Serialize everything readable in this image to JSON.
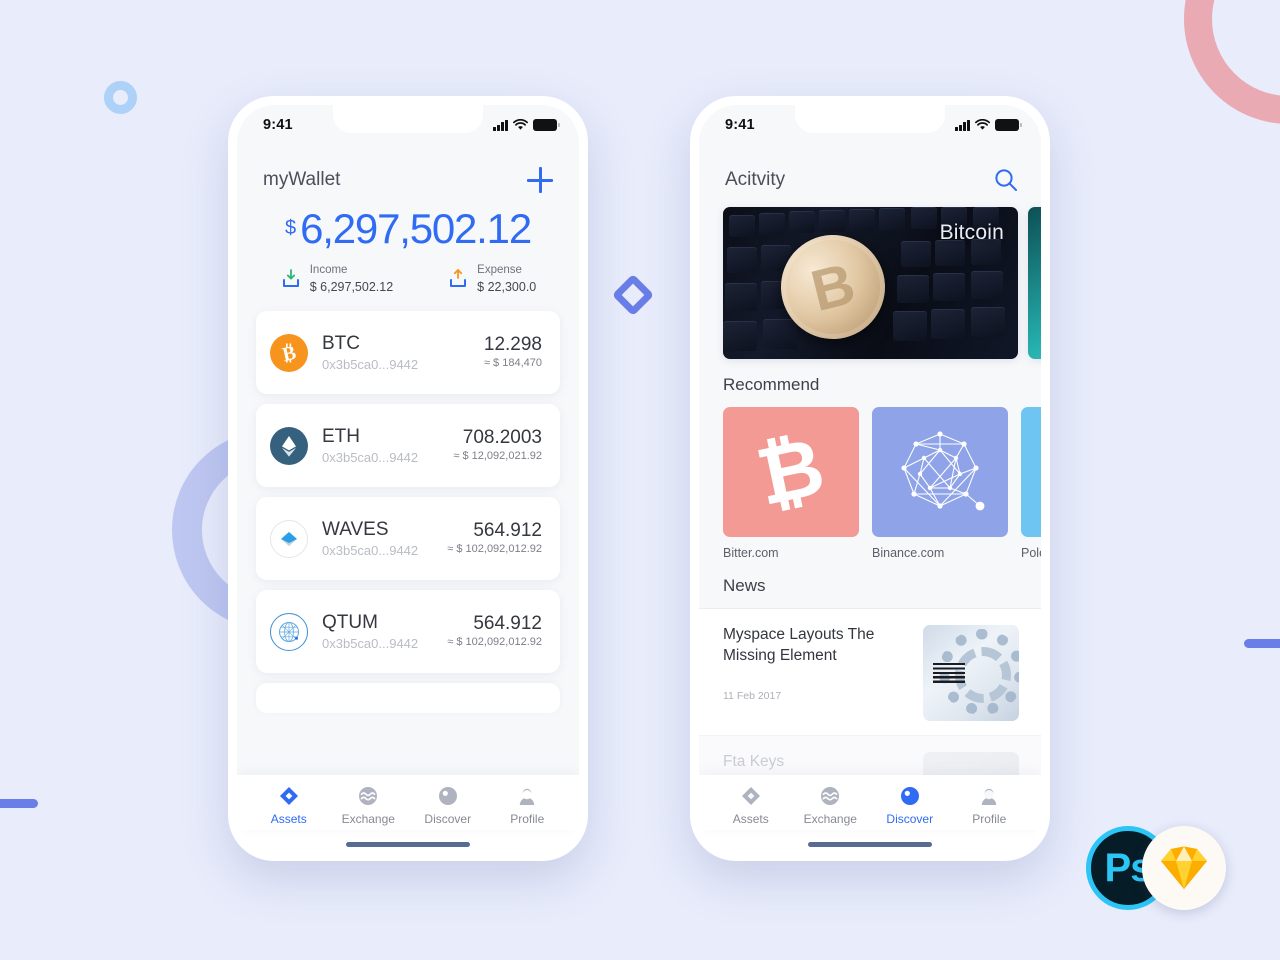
{
  "meta": {
    "background_color": "#e8ecfb",
    "accent_color": "#2f6bf3"
  },
  "decorations": {
    "ring_small_color": "#aed2f7",
    "ring_big_color": "#b6c1ee",
    "arc_pink_color": "#e9aab4",
    "diamond_color": "#6a7ee8",
    "bar_color": "#6a7ee8",
    "badges": [
      {
        "name": "photoshop-badge",
        "label": "Ps"
      },
      {
        "name": "sketch-badge",
        "label": ""
      }
    ]
  },
  "phone1": {
    "status_bar": {
      "time": "9:41",
      "signal": "signal-icon",
      "wifi": "wifi-icon",
      "battery": "battery-icon"
    },
    "header": {
      "title": "myWallet",
      "add_icon": "plus-icon"
    },
    "balance": {
      "currency_symbol": "$",
      "amount": "6,297,502.12",
      "income": {
        "label": "Income",
        "value": "$ 6,297,502.12",
        "icon": "income-arrow-down-icon"
      },
      "expense": {
        "label": "Expense",
        "value": "$ 22,300.0",
        "icon": "expense-arrow-up-icon"
      }
    },
    "assets": [
      {
        "symbol": "BTC",
        "address": "0x3b5ca0...9442",
        "amount": "12.298",
        "fiat": "≈ $ 184,470",
        "icon": "btc-coin-icon",
        "color": "#f7941e"
      },
      {
        "symbol": "ETH",
        "address": "0x3b5ca0...9442",
        "amount": "708.2003",
        "fiat": "≈ $ 12,092,021.92",
        "icon": "eth-coin-icon",
        "color": "#35617f"
      },
      {
        "symbol": "WAVES",
        "address": "0x3b5ca0...9442",
        "amount": "564.912",
        "fiat": "≈ $ 102,092,012.92",
        "icon": "waves-coin-icon",
        "color": "#28a0e8"
      },
      {
        "symbol": "QTUM",
        "address": "0x3b5ca0...9442",
        "amount": "564.912",
        "fiat": "≈ $ 102,092,012.92",
        "icon": "qtum-coin-icon",
        "color": "#2f96d8"
      }
    ],
    "tabs": [
      {
        "label": "Assets",
        "icon": "assets-diamond-icon",
        "active": true
      },
      {
        "label": "Exchange",
        "icon": "exchange-wave-icon",
        "active": false
      },
      {
        "label": "Discover",
        "icon": "discover-circle-icon",
        "active": false
      },
      {
        "label": "Profile",
        "icon": "profile-person-icon",
        "active": false
      }
    ]
  },
  "phone2": {
    "status_bar": {
      "time": "9:41",
      "signal": "signal-icon",
      "wifi": "wifi-icon",
      "battery": "battery-icon"
    },
    "header": {
      "title": "Acitvity",
      "search_icon": "search-icon"
    },
    "banners": [
      {
        "label": "Bitcoin",
        "style": "keyboard-bitcoin-photo"
      },
      {
        "label": "",
        "style": "teal-abstract-photo"
      }
    ],
    "recommend": {
      "title": "Recommend",
      "items": [
        {
          "name": "Bitter.com",
          "color": "#f39a95",
          "icon": "bitcoin-b-icon"
        },
        {
          "name": "Binance.com",
          "color": "#8ea3e8",
          "icon": "network-graph-icon"
        },
        {
          "name": "Polone",
          "color": "#6fc5f2",
          "icon": "plain-icon"
        }
      ]
    },
    "news": {
      "title": "News",
      "items": [
        {
          "title": "Myspace Layouts The Missing Element",
          "date": "11 Feb 2017",
          "thumb": "ibm-rings-photo",
          "faded": false
        },
        {
          "title": "Fta Keys",
          "date": "",
          "thumb": "avatar-photo",
          "faded": true
        }
      ]
    },
    "tabs": [
      {
        "label": "Assets",
        "icon": "assets-diamond-icon",
        "active": false
      },
      {
        "label": "Exchange",
        "icon": "exchange-wave-icon",
        "active": false
      },
      {
        "label": "Discover",
        "icon": "discover-circle-icon",
        "active": true
      },
      {
        "label": "Profile",
        "icon": "profile-person-icon",
        "active": false
      }
    ]
  }
}
